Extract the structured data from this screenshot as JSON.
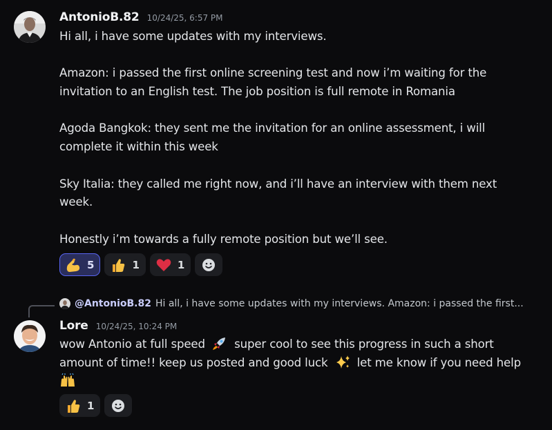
{
  "messages": [
    {
      "author": "AntonioB.82",
      "timestamp": "10/24/25, 6:57 PM",
      "avatar_icon": "person-photo",
      "paragraphs": [
        "Hi all, i have some updates with my interviews.",
        "Amazon: i passed the first online screening test and now i’m waiting for the invitation to an English test. The job position is full remote in Romania",
        "Agoda Bangkok: they sent me the invitation for an online assessment, i will complete it within this week",
        "Sky Italia: they called me right now, and i’ll have an interview with them next week.",
        "Honestly i’m towards a fully remote position but we’ll see."
      ],
      "reactions": [
        {
          "emoji": "flexed-biceps",
          "count": "5",
          "active": true
        },
        {
          "emoji": "thumbs-up",
          "count": "1",
          "active": false
        },
        {
          "emoji": "red-heart",
          "count": "1",
          "active": false
        }
      ]
    },
    {
      "author": "Lore",
      "timestamp": "10/24/25, 10:24 PM",
      "avatar_icon": "person-photo",
      "reply": {
        "mention": "@AntonioB.82",
        "preview": "Hi all, i have some updates with my interviews.  Amazon: i passed the first..."
      },
      "content": {
        "part1": "wow Antonio at full speed",
        "emoji1": "rocket",
        "part2": "super cool to see this progress in such a short amount of time!! keep us posted and good luck",
        "emoji2": "sparkles",
        "part3": "let me know if you need help",
        "emoji3": "raising-hands"
      },
      "reactions": [
        {
          "emoji": "thumbs-up",
          "count": "1",
          "active": false
        }
      ]
    }
  ],
  "colors": {
    "background": "#0b0b0d",
    "accent": "#5865f2",
    "mention": "#c9cdfb"
  }
}
